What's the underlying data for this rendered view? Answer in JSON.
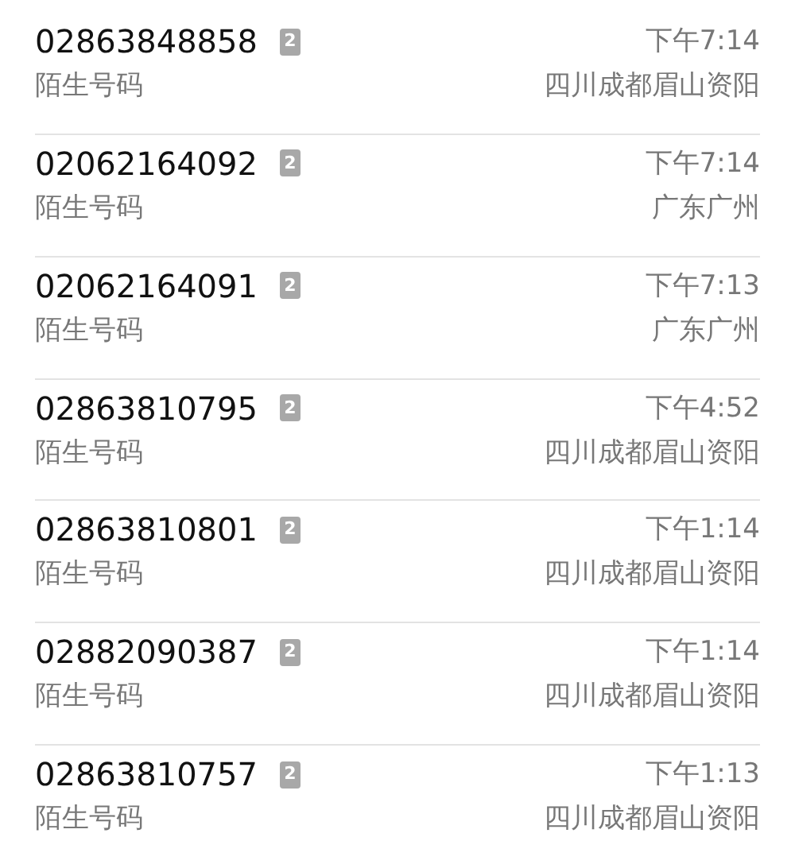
{
  "calls": [
    {
      "number": "02863848858",
      "sim": "2",
      "label": "陌生号码",
      "time": "下午7:14",
      "location": "四川成都眉山资阳"
    },
    {
      "number": "02062164092",
      "sim": "2",
      "label": "陌生号码",
      "time": "下午7:14",
      "location": "广东广州"
    },
    {
      "number": "02062164091",
      "sim": "2",
      "label": "陌生号码",
      "time": "下午7:13",
      "location": "广东广州"
    },
    {
      "number": "02863810795",
      "sim": "2",
      "label": "陌生号码",
      "time": "下午4:52",
      "location": "四川成都眉山资阳"
    },
    {
      "number": "02863810801",
      "sim": "2",
      "label": "陌生号码",
      "time": "下午1:14",
      "location": "四川成都眉山资阳"
    },
    {
      "number": "02882090387",
      "sim": "2",
      "label": "陌生号码",
      "time": "下午1:14",
      "location": "四川成都眉山资阳"
    },
    {
      "number": "02863810757",
      "sim": "2",
      "label": "陌生号码",
      "time": "下午1:13",
      "location": "四川成都眉山资阳"
    }
  ]
}
